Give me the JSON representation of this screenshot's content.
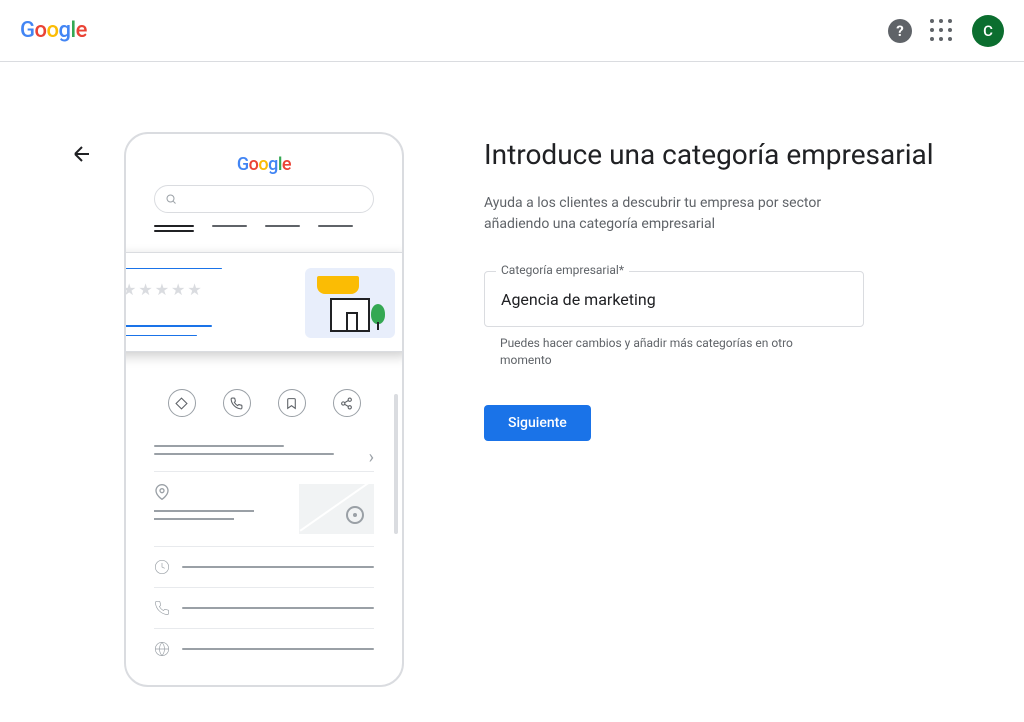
{
  "header": {
    "logo": "Google",
    "avatar_initial": "C"
  },
  "illustration": {
    "logo": "Google"
  },
  "form": {
    "title": "Introduce una categoría empresarial",
    "subtitle": "Ayuda a los clientes a descubrir tu empresa por sector añadiendo una categoría empresarial",
    "category_label": "Categoría empresarial*",
    "category_value": "Agencia de marketing",
    "helper_text": "Puedes hacer cambios y añadir más categorías en otro momento",
    "next_button": "Siguiente"
  }
}
